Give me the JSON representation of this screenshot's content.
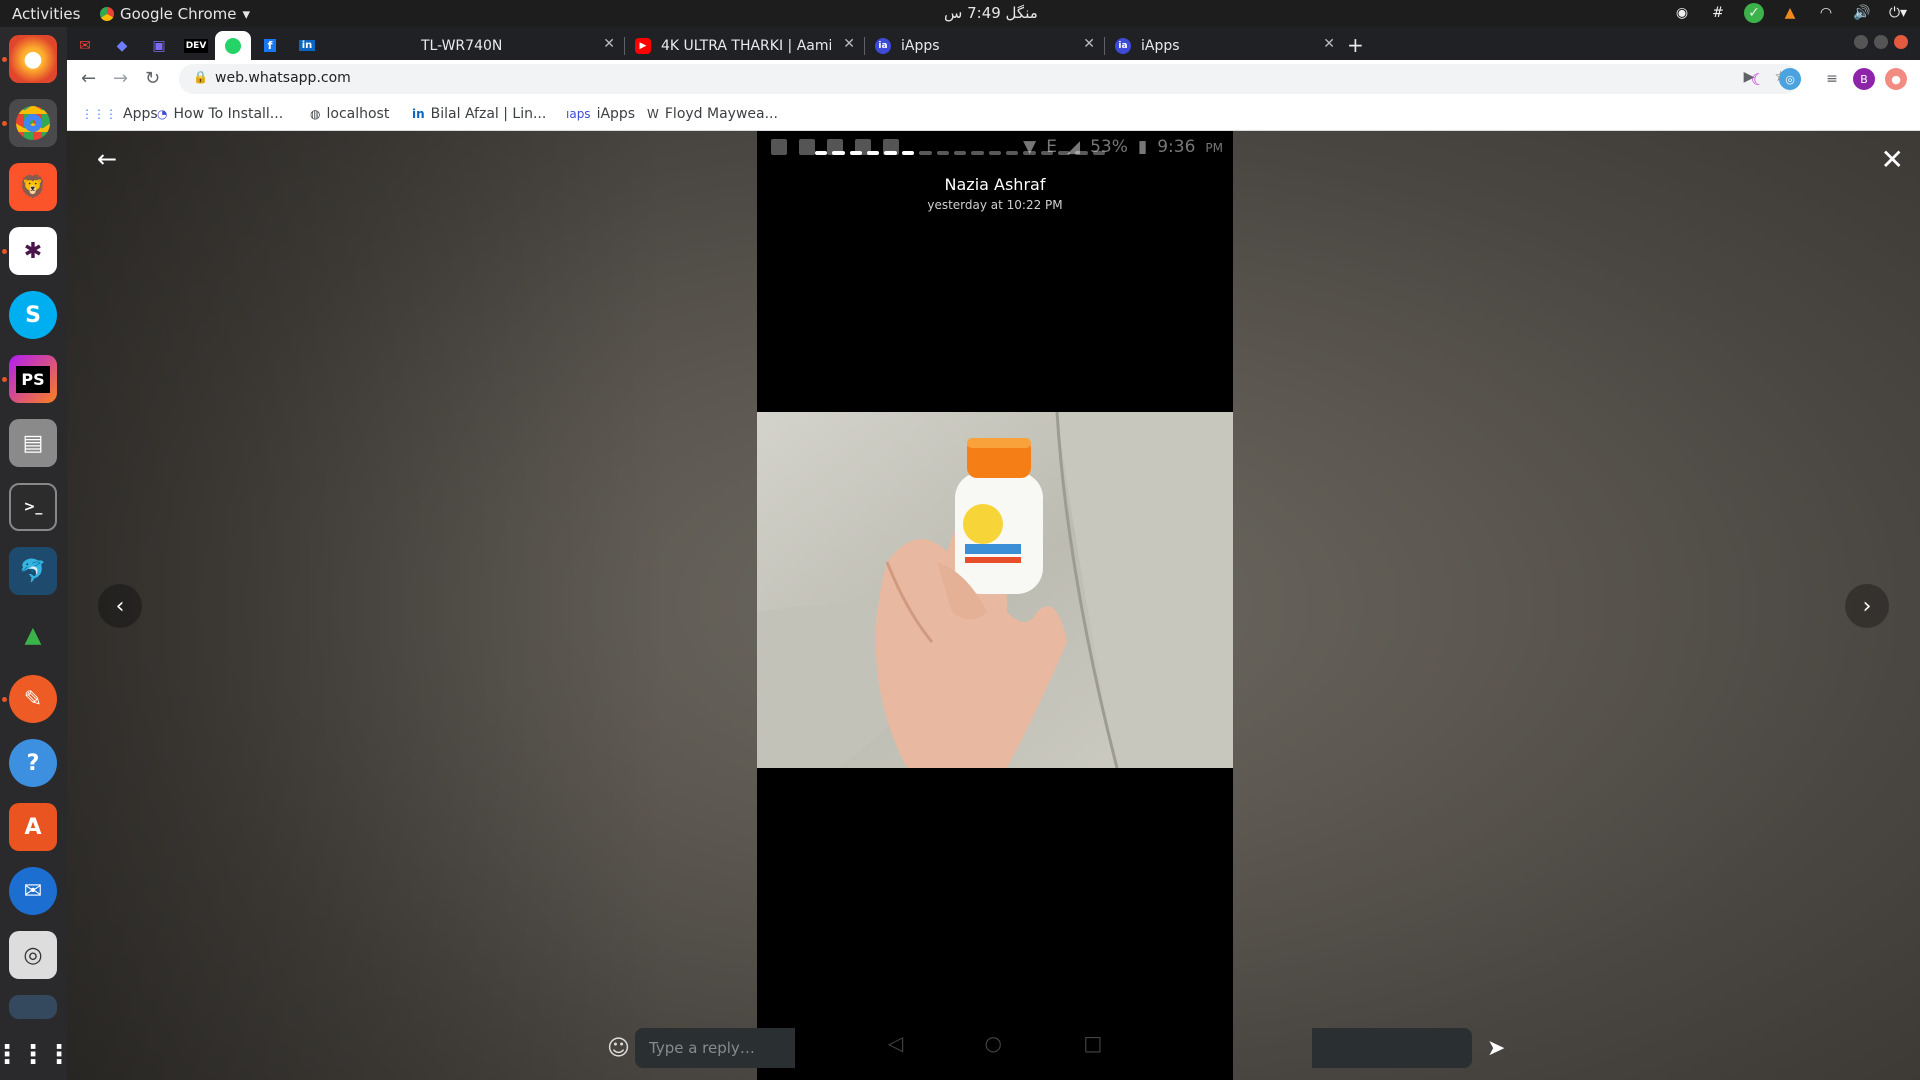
{
  "topbar": {
    "activities": "Activities",
    "app_name": "Google Chrome",
    "clock": "منگل 7:49 س"
  },
  "dock": {
    "apps": [
      "firefox-icon",
      "chrome-icon",
      "brave-icon",
      "slack-icon",
      "skype-icon",
      "phpstorm-icon",
      "files-icon",
      "terminal-icon",
      "mysql-workbench-icon",
      "rocket-icon",
      "postman-icon",
      "help-icon",
      "software-center-icon",
      "thunderbird-icon",
      "rhythmbox-icon",
      "screen-icon",
      "show-apps-icon"
    ]
  },
  "tabs": [
    {
      "title": "TL-WR740N"
    },
    {
      "title": "4K ULTRA THARKI | Aamir"
    },
    {
      "title": "iApps"
    },
    {
      "title": "iApps"
    }
  ],
  "toolbar": {
    "url": "web.whatsapp.com"
  },
  "bookmarks": [
    {
      "label": "Apps"
    },
    {
      "label": "How To Install..."
    },
    {
      "label": "localhost"
    },
    {
      "label": "Bilal Afzal | Lin..."
    },
    {
      "label": "iApps"
    },
    {
      "label": "Floyd Maywea..."
    }
  ],
  "status": {
    "poster_name": "Nazia Ashraf",
    "posted_time": "yesterday at 10:22 PM",
    "battery": "53%",
    "phone_time": "9:36",
    "phone_ampm": "PM",
    "network": "E",
    "segments_total": 17,
    "segments_viewed": 6
  },
  "reply": {
    "placeholder": "Type a reply…"
  },
  "colors": {
    "whatsapp_green": "#25d366",
    "viewer_bg": "#5b5750",
    "bottle_cap": "#f57e17"
  }
}
